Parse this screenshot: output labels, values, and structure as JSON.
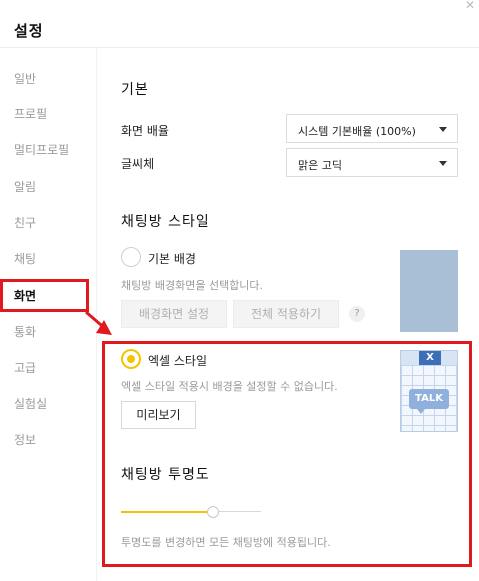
{
  "header": {
    "title": "설정",
    "close_glyph": "✕"
  },
  "sidebar": {
    "items": [
      {
        "label": "일반"
      },
      {
        "label": "프로필"
      },
      {
        "label": "멀티프로필"
      },
      {
        "label": "알림"
      },
      {
        "label": "친구"
      },
      {
        "label": "채팅"
      },
      {
        "label": "화면",
        "active": true
      },
      {
        "label": "통화"
      },
      {
        "label": "고급"
      },
      {
        "label": "실험실"
      },
      {
        "label": "정보"
      }
    ]
  },
  "basic": {
    "section_title": "기본",
    "zoom_label": "화면 배율",
    "zoom_value": "시스템 기본배율 (100%)",
    "font_label": "글씨체",
    "font_value": "맑은 고딕"
  },
  "chat_style": {
    "section_title": "채팅방 스타일",
    "basic_bg_label": "기본 배경",
    "basic_bg_checked": false,
    "basic_bg_desc": "채팅방 배경화면을 선택합니다.",
    "set_bg_button": "배경화면 설정",
    "apply_all_button": "전체 적용하기",
    "help_glyph": "?",
    "excel_label": "엑셀 스타일",
    "excel_checked": true,
    "excel_desc": "엑셀 스타일 적용시 배경을 설정할 수 없습니다.",
    "preview_button": "미리보기",
    "thumb_excel_x": "X",
    "thumb_excel_talk": "TALK"
  },
  "transparency": {
    "section_title": "채팅방 투명도",
    "level": 0.67,
    "desc": "투명도를 변경하면 모든 채팅방에 적용됩니다."
  },
  "colors": {
    "accent": "#f5c400",
    "highlight": "#e0191e",
    "thumb_blue": "#a9bfd6"
  }
}
